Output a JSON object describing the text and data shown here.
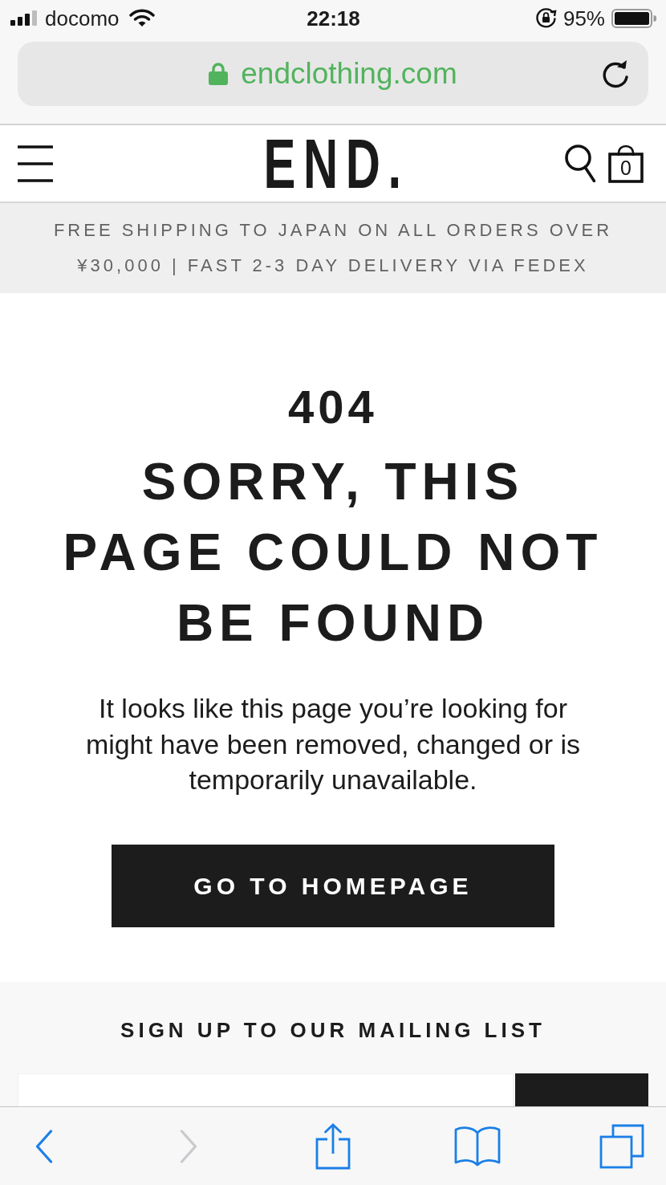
{
  "status_bar": {
    "carrier": "docomo",
    "time": "22:18",
    "battery": "95%"
  },
  "browser": {
    "url": "endclothing.com",
    "secure": true
  },
  "header": {
    "logo": "END.",
    "cart_count": "0"
  },
  "banner": {
    "text": "FREE SHIPPING TO JAPAN ON ALL ORDERS OVER ¥30,000 | FAST 2-3 DAY DELIVERY VIA FEDEX"
  },
  "error": {
    "code": "404",
    "title": "SORRY, THIS PAGE COULD NOT BE FOUND",
    "message": "It looks like this page you’re looking for might have been removed, changed or is temporarily unavailable.",
    "button": "GO TO HOMEPAGE"
  },
  "mailing_list": {
    "heading": "SIGN UP TO OUR MAILING LIST",
    "controls": [
      {
        "kind": "field"
      },
      {
        "kind": "button"
      }
    ]
  },
  "toolbar": [
    {
      "kind": "back",
      "disabled": false
    },
    {
      "kind": "forward",
      "disabled": true
    },
    {
      "kind": "share",
      "disabled": false
    },
    {
      "kind": "bookmarks",
      "disabled": false
    },
    {
      "kind": "tabs",
      "disabled": false
    }
  ]
}
